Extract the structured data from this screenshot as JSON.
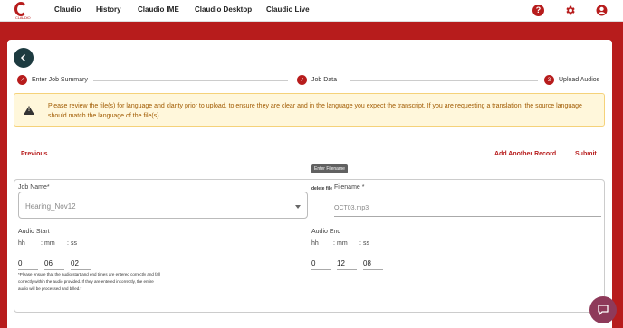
{
  "nav": {
    "logo_sub": "CLAUDIO",
    "items": [
      "Claudio",
      "History",
      "Claudio IME",
      "Claudio Desktop",
      "Claudio Live"
    ],
    "icons": [
      "help-icon",
      "gear-icon",
      "account-icon"
    ]
  },
  "steps": [
    {
      "label": "Enter Job Summary",
      "marker": "✓"
    },
    {
      "label": "Job Data",
      "marker": "✓"
    },
    {
      "label": "Upload Audios",
      "marker": "3"
    }
  ],
  "alert": {
    "text": "Please review the file(s) for language and clarity prior to upload, to ensure they are clear and in the language you expect the transcript. If you are requesting a translation, the source language should match the language of the file(s)."
  },
  "actions": {
    "previous": "Previous",
    "add_record": "Add Another Record",
    "submit": "Submit"
  },
  "tooltip": "Enter Filename",
  "form": {
    "job_name_label": "Job Name*",
    "job_name_value": "Hearing_Nov12",
    "delete_label": "delete file",
    "filename_label": "Filename *",
    "filename_value": "OCT03.mp3",
    "audio_start_label": "Audio Start",
    "audio_end_label": "Audio End",
    "hh": "hh",
    "mm": "mm",
    "ss": "ss",
    "start": {
      "hh": "0",
      "mm": "06",
      "ss": "02"
    },
    "end": {
      "hh": "0",
      "mm": "12",
      "ss": "08"
    },
    "note": "*Please ensure that the audio start and end times are entered correctly and fall correctly within the audio provided. If they are entered incorrectly, the entire audio will be processed and billed.*"
  },
  "colors": {
    "brand": "#b71c1c",
    "back_button": "#1d3b40",
    "alert_bg": "#fff7db",
    "chat": "#8e3a5a"
  }
}
